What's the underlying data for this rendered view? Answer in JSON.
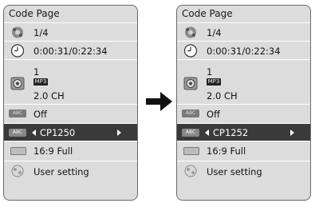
{
  "panels": [
    {
      "title": "Code Page",
      "title_icon": "speaker-icon",
      "chapter": "1/4",
      "time": "0:00:31/0:22:34",
      "audio_track": "1",
      "audio_codec": "MP3",
      "audio_channels": "2.0 CH",
      "subtitle": "Off",
      "subtitle_icon_text": "ABC",
      "code_page": "CP1250",
      "code_page_icon_text": "ABC",
      "aspect_ratio": "16:9 Full",
      "picture_mode": "User setting"
    },
    {
      "title": "Code Page",
      "title_icon": "speaker-icon",
      "chapter": "1/4",
      "time": "0:00:31/0:22:34",
      "audio_track": "1",
      "audio_codec": "MP3",
      "audio_channels": "2.0 CH",
      "subtitle": "Off",
      "subtitle_icon_text": "ABC",
      "code_page": "CP1252",
      "code_page_icon_text": "ABC",
      "aspect_ratio": "16:9 Full",
      "picture_mode": "User setting"
    }
  ],
  "colors": {
    "panel_bg": "#dcdcdc",
    "selected_row": "#3a3a3a",
    "border": "#6a6a6a"
  }
}
